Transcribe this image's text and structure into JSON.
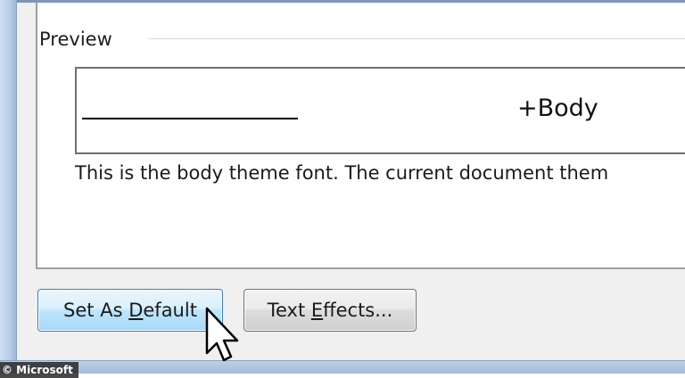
{
  "preview_section": {
    "label": "Preview",
    "sample_text": "+Body",
    "description": "This is the body theme font. The current document them"
  },
  "buttons": {
    "set_default": {
      "before": "Set As ",
      "mnemonic": "D",
      "after": "efault"
    },
    "text_effects": {
      "before": "Text ",
      "mnemonic": "E",
      "after": "ffects..."
    }
  },
  "watermark": "© Microsoft",
  "colors": {
    "default_button_border": "#3c7fb1",
    "frame": "#b8cde6"
  },
  "icons": [
    "mouse-cursor-icon"
  ]
}
